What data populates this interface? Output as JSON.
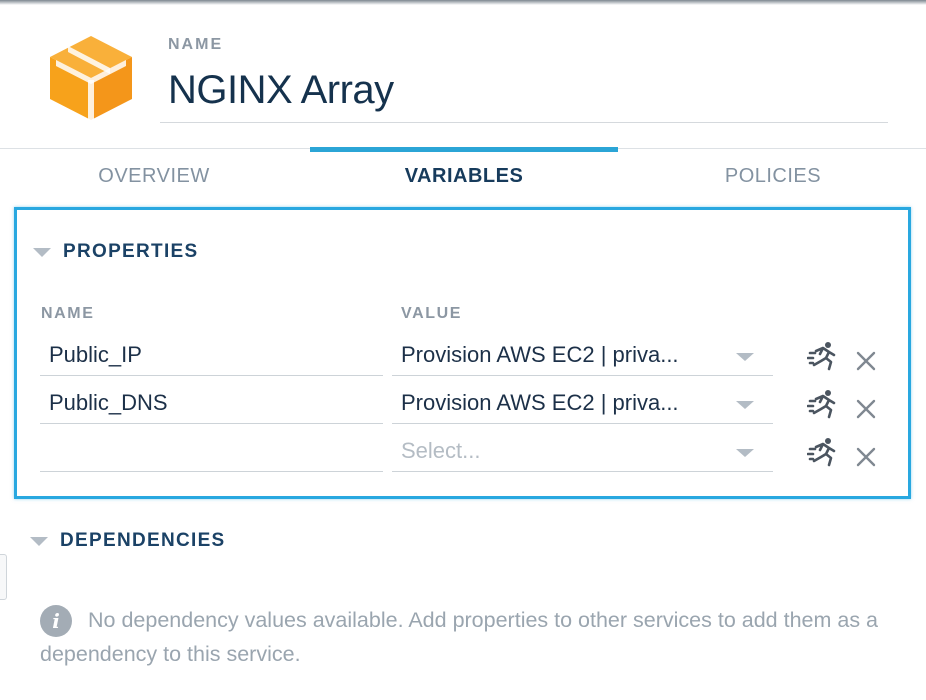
{
  "header": {
    "name_label": "NAME",
    "name_value": "NGINX Array",
    "icon": "orange-cube-icon"
  },
  "tabs": [
    {
      "label": "OVERVIEW",
      "active": false
    },
    {
      "label": "VARIABLES",
      "active": true
    },
    {
      "label": "POLICIES",
      "active": false
    }
  ],
  "properties": {
    "title": "PROPERTIES",
    "columns": {
      "name": "NAME",
      "value": "VALUE"
    },
    "rows": [
      {
        "name": "Public_IP",
        "value": "Provision AWS EC2 | priva..."
      },
      {
        "name": "Public_DNS",
        "value": "Provision AWS EC2 | priva..."
      },
      {
        "name": "",
        "value": "",
        "placeholder": "Select..."
      }
    ]
  },
  "dependencies": {
    "title": "DEPENDENCIES",
    "message": "No dependency values available. Add properties to other services to add them as a dependency to this service.",
    "info_icon_glyph": "i"
  },
  "colors": {
    "accent": "#29a8e0",
    "tab_underline": "#2ba5d6",
    "title_text": "#15324d",
    "muted_text": "#8c97a3",
    "cube_orange": "#f7a21b"
  }
}
